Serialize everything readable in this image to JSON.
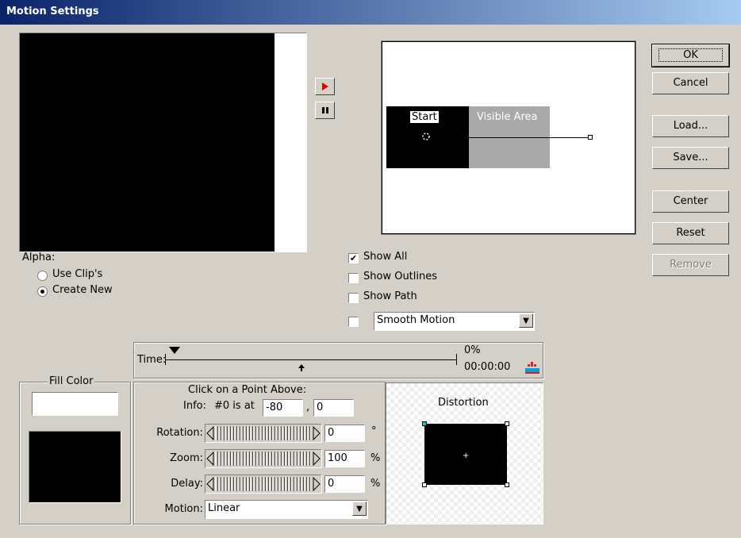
{
  "window": {
    "title": "Motion Settings"
  },
  "buttons": {
    "ok": "OK",
    "cancel": "Cancel",
    "load": "Load...",
    "save": "Save...",
    "center": "Center",
    "reset": "Reset",
    "remove": "Remove"
  },
  "preview": {
    "start_label": "Start",
    "visible_area_label": "Visible Area"
  },
  "alpha": {
    "label": "Alpha:",
    "options": [
      "Use Clip's",
      "Create New"
    ],
    "selected": "Create New"
  },
  "options": {
    "show_all": {
      "label": "Show All",
      "checked": true
    },
    "show_outlines": {
      "label": "Show Outlines",
      "checked": false
    },
    "show_path": {
      "label": "Show Path",
      "checked": false
    },
    "smooth_motion": {
      "value": "Smooth Motion",
      "checked": false
    }
  },
  "time": {
    "label": "Time:",
    "percent": "0%",
    "timecode": "00:00:00"
  },
  "fill_color": {
    "label": "Fill Color"
  },
  "point": {
    "header": "Click on a Point Above:",
    "info_label": "Info:",
    "info_text": "#0 is at",
    "x": "-80",
    "y": "0",
    "comma": ",",
    "rotation_label": "Rotation:",
    "rotation": "0",
    "rotation_unit": "°",
    "zoom_label": "Zoom:",
    "zoom": "100",
    "zoom_unit": "%",
    "delay_label": "Delay:",
    "delay": "0",
    "delay_unit": "%",
    "motion_label": "Motion:",
    "motion_value": "Linear"
  },
  "distortion": {
    "label": "Distortion"
  },
  "colors": {
    "title_start": "#0a246a",
    "title_end": "#a6caf0",
    "play_red": "#e00000",
    "visible_area_gray": "#a9a9a9"
  }
}
